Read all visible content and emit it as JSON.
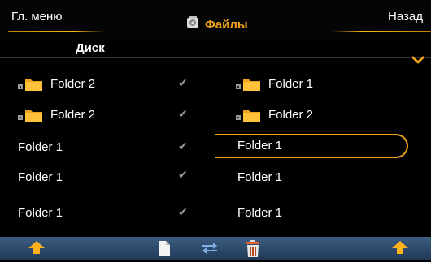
{
  "header": {
    "menu_label": "Гл. меню",
    "title": "Файлы",
    "back_label": "Назад"
  },
  "disk": {
    "label": "Диск"
  },
  "left_panel": {
    "items": [
      {
        "label": "Folder 2",
        "type": "folder",
        "checked": true
      },
      {
        "label": "Folder 2",
        "type": "folder",
        "checked": true
      },
      {
        "label": "Folder 1",
        "type": "item",
        "checked": true
      },
      {
        "label": "Folder 1",
        "type": "item",
        "checked": true
      },
      {
        "label": "Folder 1",
        "type": "item",
        "checked": true
      }
    ]
  },
  "right_panel": {
    "items": [
      {
        "label": "Folder 1",
        "type": "folder"
      },
      {
        "label": "Folder 2",
        "type": "folder"
      },
      {
        "label": "Folder 1",
        "type": "item",
        "selected": true
      },
      {
        "label": "Folder 1",
        "type": "item"
      },
      {
        "label": "Folder 1",
        "type": "item"
      }
    ]
  },
  "toolbar": {
    "icons": [
      "up-arrow-icon",
      "document-icon",
      "transfer-icon",
      "trash-icon",
      "up-arrow-icon"
    ]
  },
  "colors": {
    "accent": "#f0a21a",
    "toolbar": "#2c4a70",
    "background": "#000000"
  }
}
